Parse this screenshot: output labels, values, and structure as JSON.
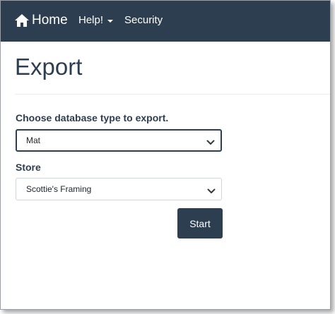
{
  "navbar": {
    "brand_label": "Home",
    "brand_icon": "home-icon",
    "help_label": "Help!",
    "security_label": "Security",
    "background": "#2d3e50"
  },
  "page": {
    "title": "Export"
  },
  "form": {
    "db_type_label": "Choose database type to export.",
    "db_type_selected": "Mat",
    "store_label": "Store",
    "store_selected": "Scottie's Framing",
    "start_label": "Start"
  }
}
